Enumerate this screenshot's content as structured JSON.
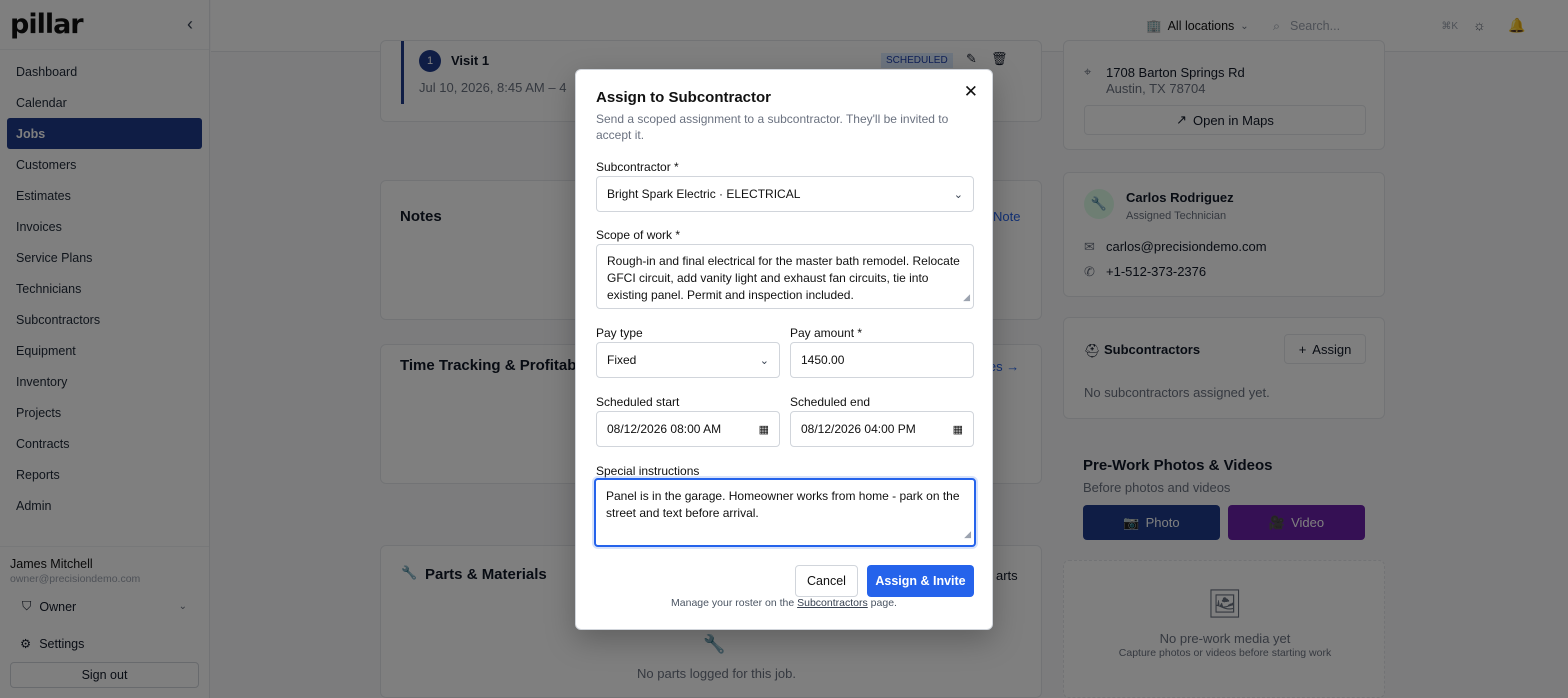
{
  "app": {
    "logo": "pillar",
    "collapse_icon": "chevron-left-icon"
  },
  "sidebar": {
    "items": [
      {
        "label": "Dashboard"
      },
      {
        "label": "Calendar"
      },
      {
        "label": "Jobs",
        "active": true
      },
      {
        "label": "Customers"
      },
      {
        "label": "Estimates"
      },
      {
        "label": "Invoices"
      },
      {
        "label": "Service Plans"
      },
      {
        "label": "Technicians"
      },
      {
        "label": "Subcontractors"
      },
      {
        "label": "Equipment"
      },
      {
        "label": "Inventory"
      },
      {
        "label": "Projects"
      },
      {
        "label": "Contracts"
      },
      {
        "label": "Reports"
      },
      {
        "label": "Admin"
      }
    ],
    "user": {
      "name": "James Mitchell",
      "email": "owner@precisiondemo.com",
      "role": "Owner"
    },
    "settings_label": "Settings",
    "signout_label": "Sign out"
  },
  "topbar": {
    "location_label": "All locations",
    "search_placeholder": "Search...",
    "search_shortcut": "⌘K"
  },
  "background": {
    "visit": {
      "number": "1",
      "title": "Visit 1",
      "status": "SCHEDULED",
      "when": "Jul 10, 2026, 8:45 AM – 4"
    },
    "notes_title": "Notes",
    "notes_action": "Note",
    "time_title": "Time Tracking & Profitab",
    "time_action": "ies →",
    "parts_title": "Parts & Materials",
    "parts_action": "arts",
    "parts_empty": "No parts logged for this job.",
    "address_line1": "1708 Barton Springs Rd",
    "address_line2": "Austin, TX 78704",
    "open_maps": "Open in Maps",
    "tech_name": "Carlos Rodriguez",
    "tech_role": "Assigned Technician",
    "tech_email": "carlos@precisiondemo.com",
    "tech_phone": "+1-512-373-2376",
    "subs_title": "Subcontractors",
    "subs_assign": "Assign",
    "subs_empty": "No subcontractors assigned yet.",
    "photos_title": "Pre-Work Photos & Videos",
    "photos_sub": "Before photos and videos",
    "photo_btn": "Photo",
    "video_btn": "Video",
    "media_empty": "No pre-work media yet",
    "media_hint": "Capture photos or videos before starting work"
  },
  "modal": {
    "title": "Assign to Subcontractor",
    "description": "Send a scoped assignment to a subcontractor. They'll be invited to accept it.",
    "subcontractor_label": "Subcontractor *",
    "subcontractor_value": "Bright Spark Electric · ELECTRICAL",
    "scope_label": "Scope of work *",
    "scope_value": "Rough-in and final electrical for the master bath remodel. Relocate GFCI circuit, add vanity light and exhaust fan circuits, tie into existing panel. Permit and inspection included.",
    "pay_type_label": "Pay type",
    "pay_type_value": "Fixed",
    "pay_amount_label": "Pay amount *",
    "pay_amount_value": "1450.00",
    "start_label": "Scheduled start",
    "start_value": "08/12/2026 08:00 AM",
    "end_label": "Scheduled end",
    "end_value": "08/12/2026 04:00 PM",
    "instructions_label": "Special instructions",
    "instructions_value": "Panel is in the garage. Homeowner works from home - park on the street and text before arrival.",
    "cancel_label": "Cancel",
    "assign_label": "Assign & Invite",
    "footnote_prefix": "Manage your roster on the",
    "footnote_link": "Subcontractors",
    "footnote_suffix": "page."
  },
  "colors": {
    "primary": "#2563eb",
    "sidebar_active": "#1e3a8a",
    "photo_btn": "#1e3a8a",
    "video_btn": "#6b21a8"
  }
}
